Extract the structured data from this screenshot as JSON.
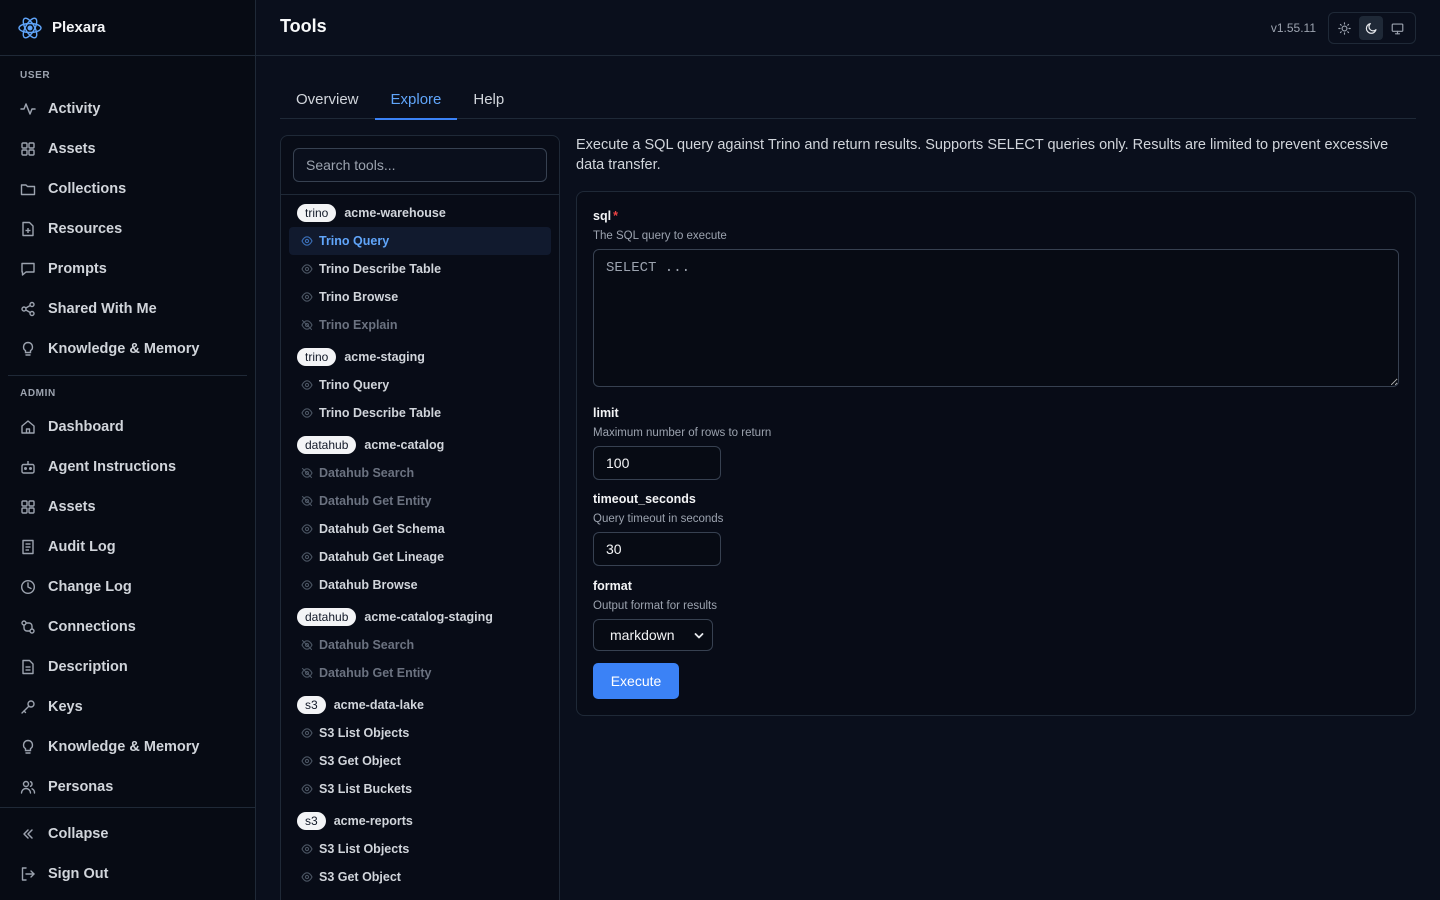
{
  "app": {
    "name": "Plexara"
  },
  "sidebar": {
    "user_label": "USER",
    "user_items": [
      {
        "label": "Activity",
        "icon": "activity-icon"
      },
      {
        "label": "Assets",
        "icon": "grid-icon"
      },
      {
        "label": "Collections",
        "icon": "folder-icon"
      },
      {
        "label": "Resources",
        "icon": "file-icon"
      },
      {
        "label": "Prompts",
        "icon": "message-icon"
      },
      {
        "label": "Shared With Me",
        "icon": "share-icon"
      },
      {
        "label": "Knowledge & Memory",
        "icon": "lightbulb-icon"
      }
    ],
    "admin_label": "ADMIN",
    "admin_items": [
      {
        "label": "Dashboard",
        "icon": "home-icon"
      },
      {
        "label": "Agent Instructions",
        "icon": "bot-icon"
      },
      {
        "label": "Assets",
        "icon": "grid-icon"
      },
      {
        "label": "Audit Log",
        "icon": "log-icon"
      },
      {
        "label": "Change Log",
        "icon": "clock-icon"
      },
      {
        "label": "Connections",
        "icon": "connection-icon"
      },
      {
        "label": "Description",
        "icon": "file-text-icon"
      },
      {
        "label": "Keys",
        "icon": "key-icon"
      },
      {
        "label": "Knowledge & Memory",
        "icon": "lightbulb-icon"
      },
      {
        "label": "Personas",
        "icon": "users-icon"
      }
    ],
    "collapse_label": "Collapse",
    "signout_label": "Sign Out"
  },
  "header": {
    "title": "Tools",
    "version": "v1.55.11",
    "theme_options": [
      "sun-icon",
      "moon-icon",
      "monitor-icon"
    ],
    "active_theme": "moon-icon"
  },
  "tabs": [
    {
      "label": "Overview",
      "active": false
    },
    {
      "label": "Explore",
      "active": true
    },
    {
      "label": "Help",
      "active": false
    }
  ],
  "tools": {
    "search_placeholder": "Search tools...",
    "groups": [
      {
        "badge": "trino",
        "name": "acme-warehouse",
        "items": [
          {
            "label": "Trino Query",
            "dim": false,
            "selected": true
          },
          {
            "label": "Trino Describe Table",
            "dim": false
          },
          {
            "label": "Trino Browse",
            "dim": false
          },
          {
            "label": "Trino Explain",
            "dim": true
          }
        ]
      },
      {
        "badge": "trino",
        "name": "acme-staging",
        "items": [
          {
            "label": "Trino Query",
            "dim": false
          },
          {
            "label": "Trino Describe Table",
            "dim": false
          }
        ]
      },
      {
        "badge": "datahub",
        "name": "acme-catalog",
        "items": [
          {
            "label": "Datahub Search",
            "dim": true
          },
          {
            "label": "Datahub Get Entity",
            "dim": true
          },
          {
            "label": "Datahub Get Schema",
            "dim": false
          },
          {
            "label": "Datahub Get Lineage",
            "dim": false
          },
          {
            "label": "Datahub Browse",
            "dim": false
          }
        ]
      },
      {
        "badge": "datahub",
        "name": "acme-catalog-staging",
        "items": [
          {
            "label": "Datahub Search",
            "dim": true
          },
          {
            "label": "Datahub Get Entity",
            "dim": true
          }
        ]
      },
      {
        "badge": "s3",
        "name": "acme-data-lake",
        "items": [
          {
            "label": "S3 List Objects",
            "dim": false
          },
          {
            "label": "S3 Get Object",
            "dim": false
          },
          {
            "label": "S3 List Buckets",
            "dim": false
          }
        ]
      },
      {
        "badge": "s3",
        "name": "acme-reports",
        "items": [
          {
            "label": "S3 List Objects",
            "dim": false
          },
          {
            "label": "S3 Get Object",
            "dim": false
          }
        ]
      }
    ]
  },
  "tool_detail": {
    "description": "Execute a SQL query against Trino and return results. Supports SELECT queries only. Results are limited to prevent excessive data transfer.",
    "sql": {
      "label": "sql",
      "required_mark": "*",
      "description": "The SQL query to execute",
      "placeholder": "SELECT ...",
      "value": ""
    },
    "limit": {
      "label": "limit",
      "description": "Maximum number of rows to return",
      "value": "100"
    },
    "timeout": {
      "label": "timeout_seconds",
      "description": "Query timeout in seconds",
      "value": "30"
    },
    "format": {
      "label": "format",
      "description": "Output format for results",
      "value": "markdown"
    },
    "execute_label": "Execute"
  },
  "colors": {
    "accent": "#3b82f6",
    "accent_text": "#60a5fa",
    "required": "#ef4444"
  }
}
